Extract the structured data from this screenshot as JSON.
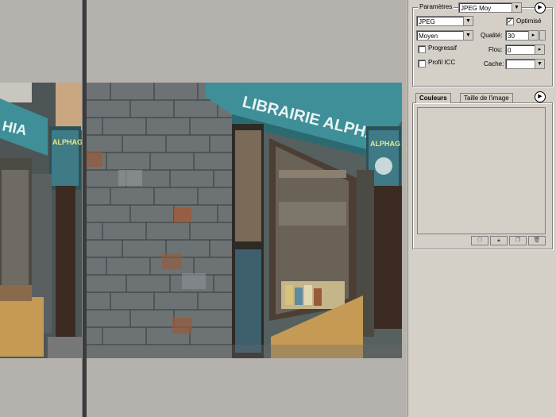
{
  "settings": {
    "legend": "Paramètres",
    "preset": "JPEG Moy",
    "format": "JPEG",
    "quality_level": "Moyen",
    "optimised_label": "Optimisé",
    "optimised_checked": true,
    "quality_label": "Qualité:",
    "quality_value": "30",
    "progressive_label": "Progressif",
    "progressive_checked": false,
    "blur_label": "Flou:",
    "blur_value": "0",
    "icc_label": "Profil ICC",
    "icc_checked": false,
    "matte_label": "Cache:",
    "matte_value": ""
  },
  "panel_tabs": [
    {
      "label": "Couleurs",
      "active": true
    },
    {
      "label": "Taille de l'image",
      "active": false
    }
  ],
  "colors": {
    "panel_bg": "#d4d0c8",
    "canvas_bg": "#b5b2ad",
    "shop_teal": "#3f8f98",
    "wall_stone": "#6d7374"
  },
  "icons": {
    "menu": "play-right-icon",
    "palette_buttons": [
      "map-web-icon",
      "lock-icon",
      "new-color-icon",
      "trash-icon"
    ]
  }
}
